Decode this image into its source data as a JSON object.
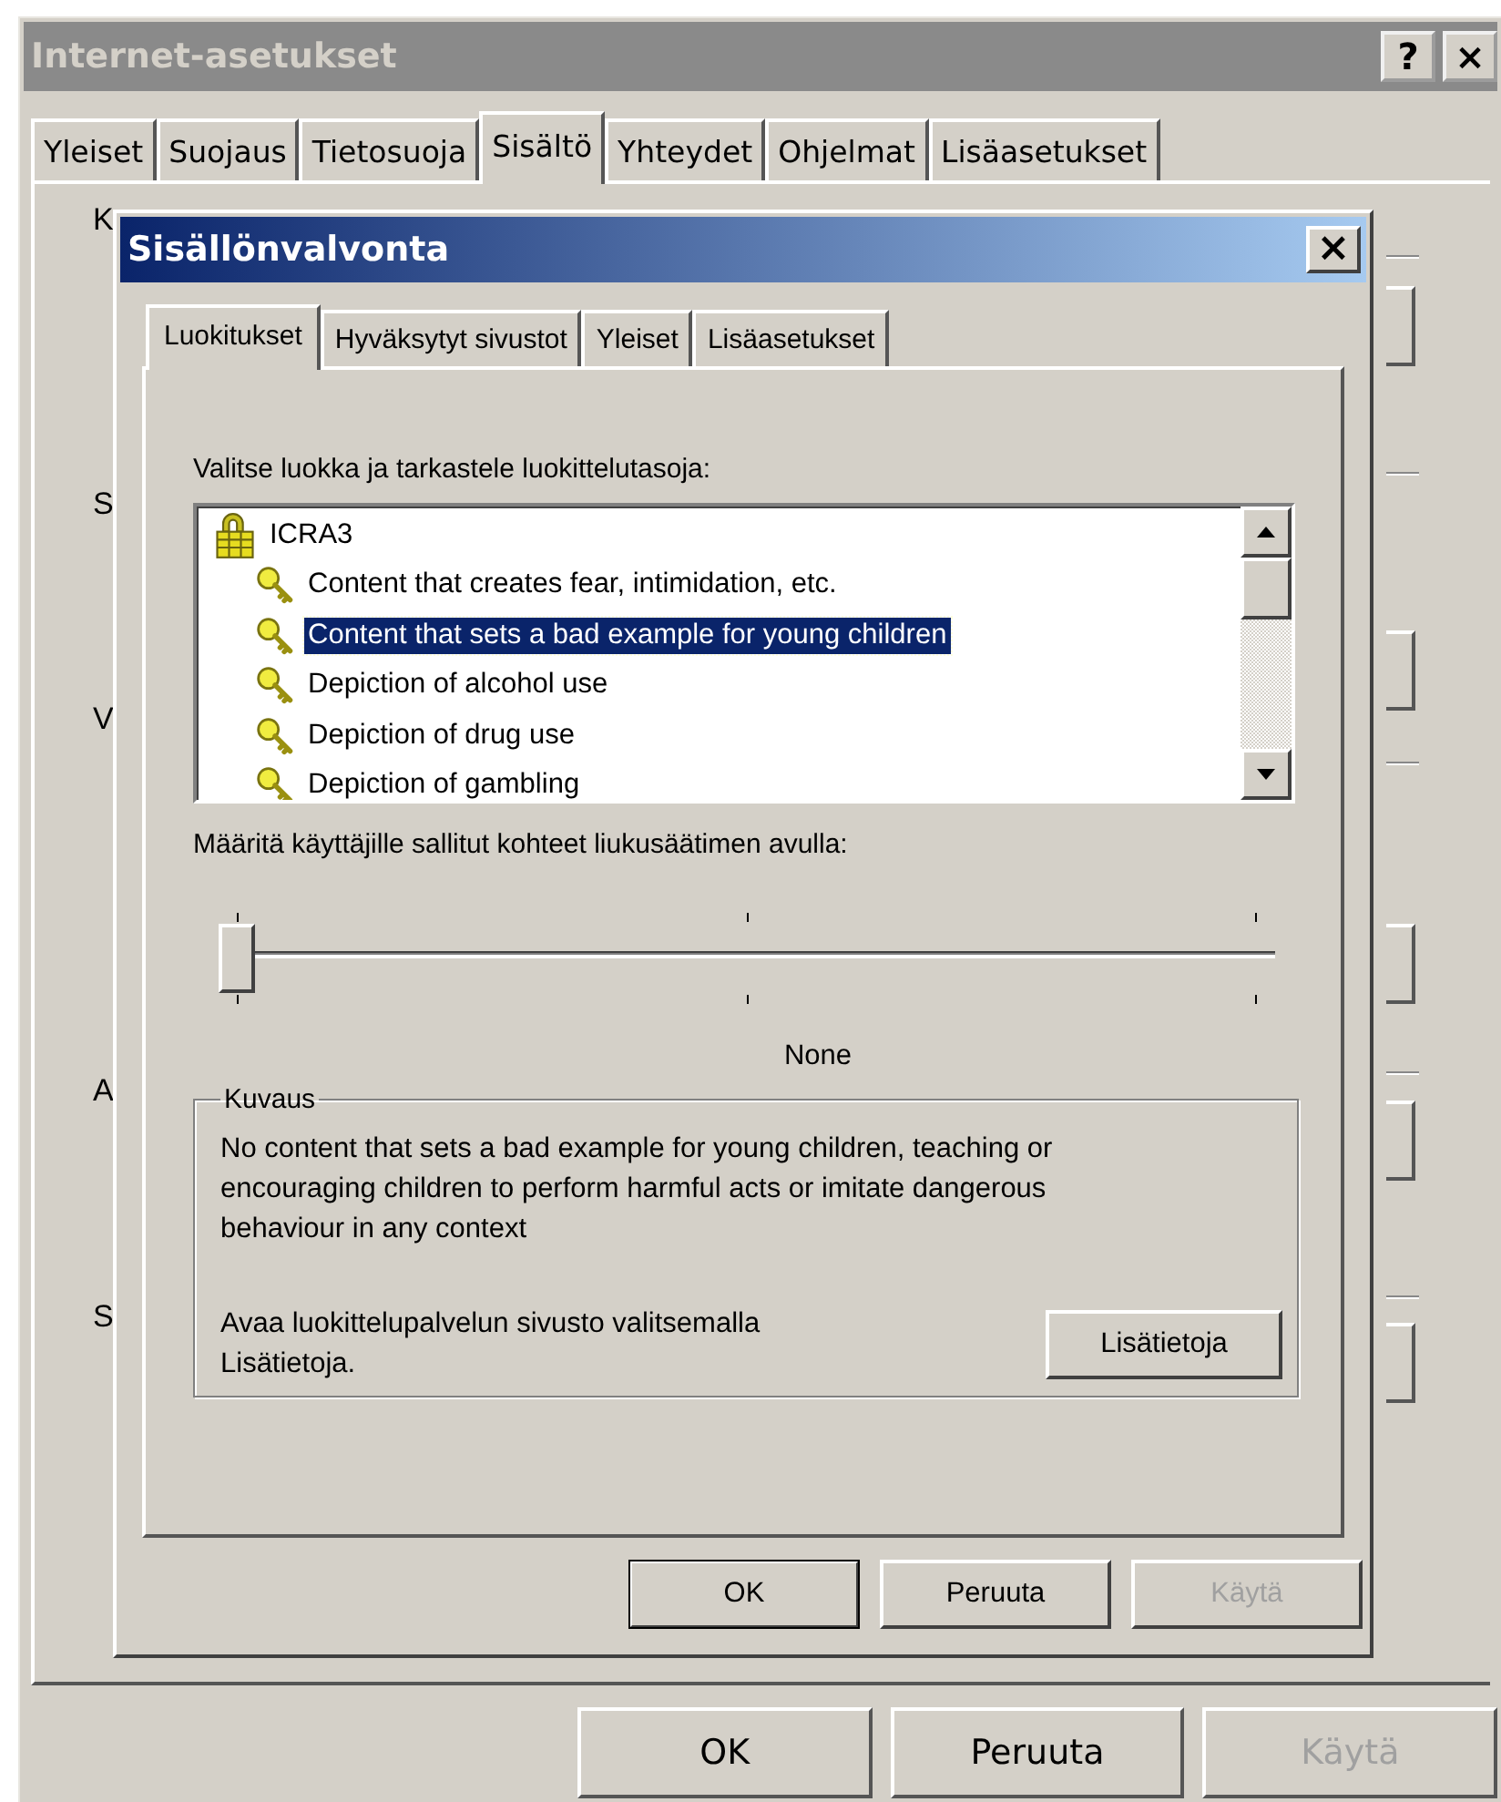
{
  "window": {
    "title": "Internet-asetukset",
    "help_button": "?",
    "close_button": "×"
  },
  "tabs": [
    {
      "label": "Yleiset",
      "selected": false
    },
    {
      "label": "Suojaus",
      "selected": false
    },
    {
      "label": "Tietosuoja",
      "selected": false
    },
    {
      "label": "Sisältö",
      "selected": true
    },
    {
      "label": "Yhteydet",
      "selected": false
    },
    {
      "label": "Ohjelmat",
      "selected": false
    },
    {
      "label": "Lisäasetukset",
      "selected": false
    }
  ],
  "hidden_labels": [
    "K",
    "S",
    "V",
    "A",
    "S"
  ],
  "buttons": [
    {
      "label": "OK",
      "disabled": false
    },
    {
      "label": "Peruuta",
      "disabled": false
    },
    {
      "label": "Käytä",
      "disabled": true
    }
  ],
  "dialog": {
    "title": "Sisällönvalvonta",
    "close_button": "×",
    "tabs": [
      {
        "label": "Luokitukset",
        "selected": true
      },
      {
        "label": "Hyväksytyt sivustot",
        "selected": false
      },
      {
        "label": "Yleiset",
        "selected": false
      },
      {
        "label": "Lisäasetukset",
        "selected": false
      }
    ],
    "category_label": "Valitse luokka ja tarkastele luokittelutasoja:",
    "tree": {
      "label": "ICRA3",
      "children": [
        {
          "label": "Content that creates fear, intimidation, etc.",
          "selected": false
        },
        {
          "label": "Content that sets a bad example for young children",
          "selected": true
        },
        {
          "label": "Depiction of alcohol use",
          "selected": false
        },
        {
          "label": "Depiction of drug use",
          "selected": false
        },
        {
          "label": "Depiction of gambling",
          "selected": false
        }
      ]
    },
    "slider_label": "Määritä käyttäjille sallitut kohteet liukusäätimen avulla:",
    "slider": {
      "level": 0
    },
    "slider_value": "None",
    "description": {
      "legend": "Kuvaus",
      "text": "No content that sets a bad example for young children, teaching or encouraging children to perform harmful acts or imitate dangerous behaviour in any context",
      "info_text": "Avaa luokittelupalvelun sivusto valitsemalla Lisätietoja.",
      "info_button": "Lisätietoja"
    },
    "buttons": [
      {
        "label": "OK",
        "disabled": false
      },
      {
        "label": "Peruuta",
        "disabled": false
      },
      {
        "label": "Käytä",
        "disabled": true
      }
    ]
  }
}
